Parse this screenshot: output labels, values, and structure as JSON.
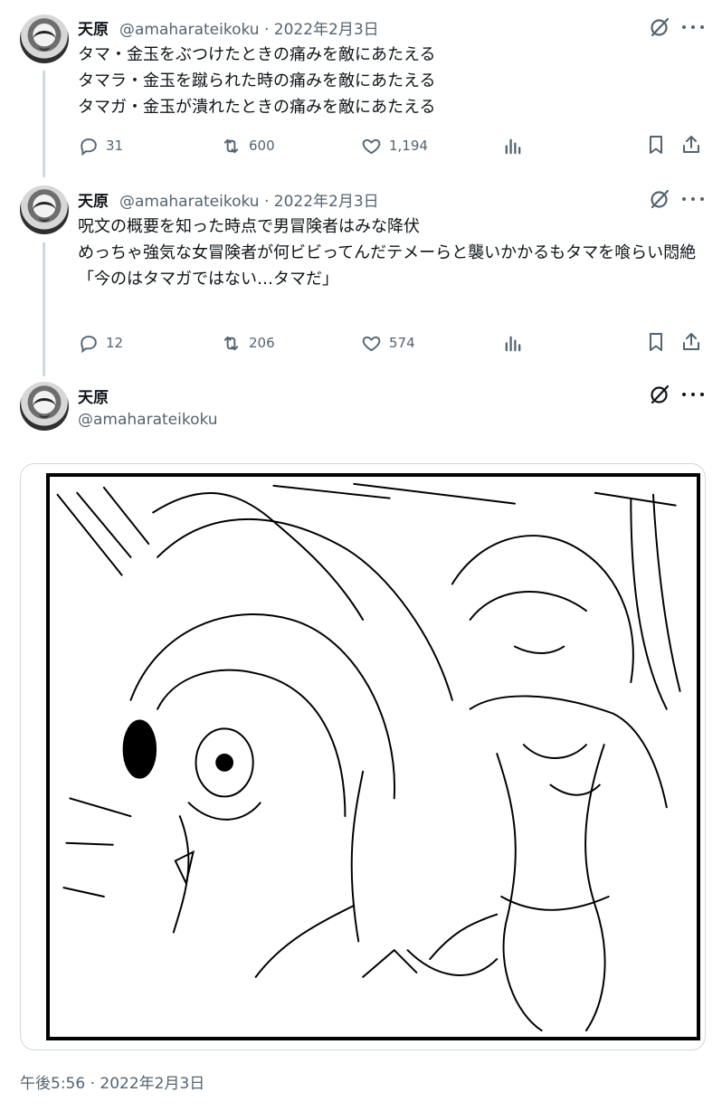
{
  "posts": [
    {
      "name": "天原",
      "meta": "@amaharateikoku · 2022年2月3日",
      "lines": [
        "タマ・金玉をぶつけたときの痛みを敵にあたえる",
        "タマラ・金玉を蹴られた時の痛みを敵にあたえる",
        "タマガ・金玉が潰れたときの痛みを敵にあたえる"
      ],
      "stats": {
        "replies": "31",
        "retweets": "600",
        "likes": "1,194"
      }
    },
    {
      "name": "天原",
      "meta": "@amaharateikoku · 2022年2月3日",
      "lines": [
        "呪文の概要を知った時点で男冒険者はみな降伏",
        "めっちゃ強気な女冒険者が何ビビってんだテメーらと襲いかかるもタマを喰らい悶絶",
        "「今のはタマガではない…タマだ」"
      ],
      "stats": {
        "replies": "12",
        "retweets": "206",
        "likes": "574"
      }
    }
  ],
  "focus": {
    "name": "天原",
    "handle": "@amaharateikoku",
    "timestamp": "午後5:56 · 2022年2月3日"
  },
  "icons": {
    "reply": "reply-icon",
    "retweet": "retweet-icon",
    "like": "like-icon",
    "views": "views-icon",
    "bookmark": "bookmark-icon",
    "share": "share-icon",
    "grok": "grok-icon",
    "more": "more-icon"
  },
  "colors": {
    "text": "#0f1419",
    "muted": "#536471",
    "thread": "#cfd9de"
  }
}
